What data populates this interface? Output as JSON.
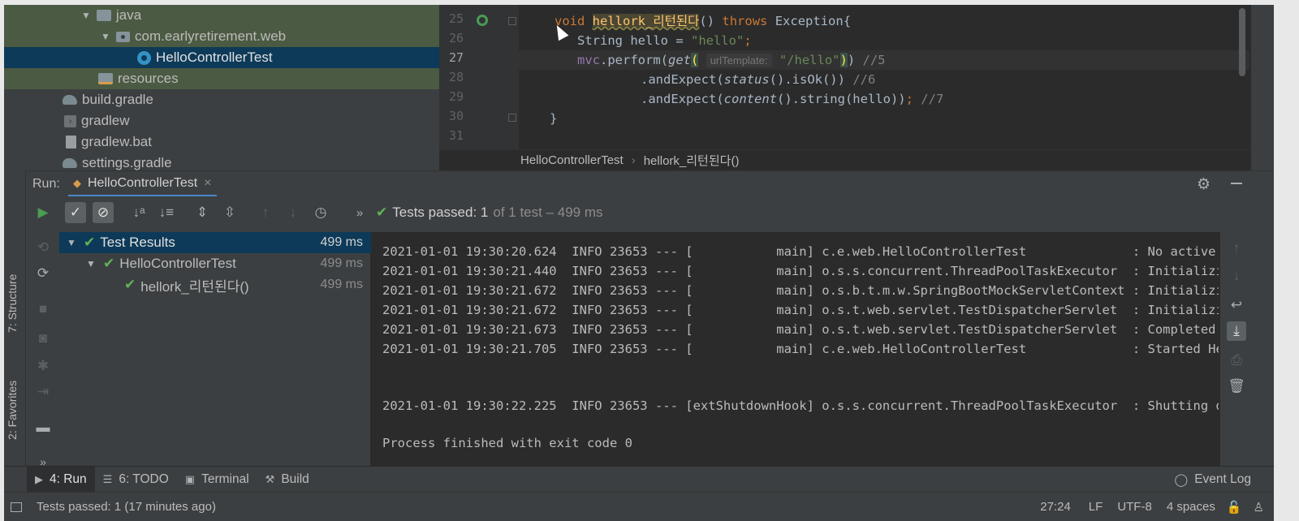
{
  "project_tree": {
    "items": [
      {
        "label": "java"
      },
      {
        "label": "com.earlyretirement.web"
      },
      {
        "label": "HelloControllerTest"
      },
      {
        "label": "resources"
      },
      {
        "label": "build.gradle"
      },
      {
        "label": "gradlew"
      },
      {
        "label": "gradlew.bat"
      },
      {
        "label": "settings.gradle"
      }
    ]
  },
  "editor": {
    "line_numbers": [
      "25",
      "26",
      "27",
      "28",
      "29",
      "30",
      "31"
    ],
    "current_line": "27",
    "lines": {
      "l25": {
        "kw1": "void",
        "method": "hellork_리턴된다",
        "rest1": "() ",
        "kw2": "throws",
        "rest2": " Exception{"
      },
      "l26": {
        "text": "String hello = ",
        "str": "\"hello\"",
        "end": ";"
      },
      "l27": {
        "field": "mvc",
        "mid": ".perform(",
        "call": "get",
        "open": "(",
        "hint": "urlTemplate:",
        "str": "\"/hello\"",
        "close1": ")",
        "close2": ")",
        "comment": " //5"
      },
      "l28": {
        "pre": ".andExpect(",
        "call": "status",
        "post": "().isOk()) ",
        "comment": "//6"
      },
      "l29": {
        "pre": ".andExpect(",
        "call": "content",
        "post": "().string(hello))",
        "semi": "; ",
        "comment": "//7"
      },
      "l30": {
        "text": "}"
      }
    },
    "breadcrumb": [
      "HelloControllerTest",
      "hellork_리턴된다()"
    ]
  },
  "run_panel": {
    "label": "Run:",
    "tab": "HelloControllerTest",
    "close_glyph": "×",
    "summary": {
      "passed": "Tests passed: 1",
      "rest": "of 1 test – 499 ms"
    },
    "results": [
      {
        "label": "Test Results",
        "time": "499 ms"
      },
      {
        "label": "HelloControllerTest",
        "time": "499 ms"
      },
      {
        "label": "hellork_리턴된다()",
        "time": "499 ms"
      }
    ],
    "console": [
      "2021-01-01 19:30:20.624  INFO 23653 --- [           main] c.e.web.HelloControllerTest              : No active p",
      "2021-01-01 19:30:21.440  INFO 23653 --- [           main] o.s.s.concurrent.ThreadPoolTaskExecutor  : Initializin",
      "2021-01-01 19:30:21.672  INFO 23653 --- [           main] o.s.b.t.m.w.SpringBootMockServletContext : Initializin",
      "2021-01-01 19:30:21.672  INFO 23653 --- [           main] o.s.t.web.servlet.TestDispatcherServlet  : Initializin",
      "2021-01-01 19:30:21.673  INFO 23653 --- [           main] o.s.t.web.servlet.TestDispatcherServlet  : Completed i",
      "2021-01-01 19:30:21.705  INFO 23653 --- [           main] c.e.web.HelloControllerTest              : Started Hel",
      "2021-01-01 19:30:22.225  INFO 23653 --- [extShutdownHook] o.s.s.concurrent.ThreadPoolTaskExecutor  : Shutting do",
      "Process finished with exit code 0"
    ]
  },
  "side_tabs": {
    "structure": "7: Structure",
    "favorites": "2: Favorites"
  },
  "bottom_tabs": [
    {
      "label": "4: Run"
    },
    {
      "label": "6: TODO"
    },
    {
      "label": "Terminal"
    },
    {
      "label": "Build"
    }
  ],
  "event_log": "Event Log",
  "status": {
    "message": "Tests passed: 1 (17 minutes ago)",
    "position": "27:24",
    "line_sep": "LF",
    "encoding": "UTF-8",
    "indent": "4 spaces"
  },
  "colors": {
    "background": "#2b2b2b",
    "panel": "#3c3f41",
    "selection": "#0d3a58",
    "keyword": "#cc7832",
    "string": "#6a8759",
    "success": "#5fb357"
  }
}
